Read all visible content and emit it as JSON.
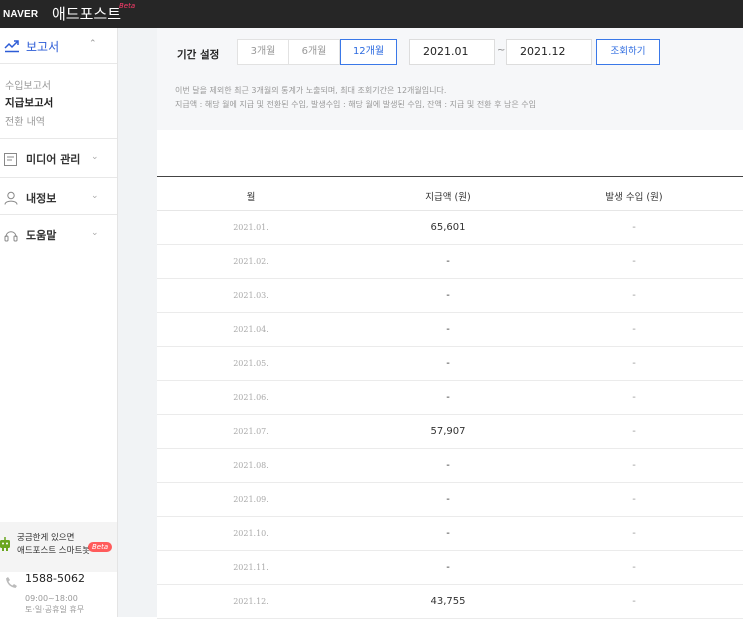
{
  "header": {
    "brand_naver": "NAVER",
    "brand_name": "애드포스트",
    "brand_badge": "Beta"
  },
  "sidebar": {
    "report": {
      "label": "보고서",
      "icon": "chart-line-icon"
    },
    "sub_items": [
      {
        "label": "수입보고서"
      },
      {
        "label": "지급보고서",
        "active": true
      },
      {
        "label": "전환 내역"
      }
    ],
    "menus": [
      {
        "label": "미디어 관리",
        "icon": "document-icon"
      },
      {
        "label": "내정보",
        "icon": "person-icon"
      },
      {
        "label": "도움말",
        "icon": "headset-icon"
      }
    ],
    "chatbot": {
      "line1": "궁금한게 있으면",
      "line2": "애드포스트 스마트봇",
      "badge": "Beta"
    },
    "phone": "1588-5062",
    "hours": "09:00~18:00",
    "days": "토·일·공휴일 휴무"
  },
  "filter": {
    "label": "기간 설정",
    "periods": [
      {
        "label": "3개월",
        "active": false
      },
      {
        "label": "6개월",
        "active": false
      },
      {
        "label": "12개월",
        "active": true
      }
    ],
    "start": "2021.01",
    "end": "2021.12",
    "tilde": "~",
    "search_label": "조회하기",
    "note1": "이번 달을 제외한 최근 3개월의 통계가 노출되며, 최대 조회기간은 12개월입니다.",
    "note2": "지급액 : 해당 월에 지급 및 전환된 수입, 발생수입 : 해당 월에 발생된 수입, 잔액 : 지급 및 전환 후 남은 수입"
  },
  "table": {
    "headers": {
      "month": "월",
      "paid": "지급액 (원)",
      "occurred": "발생 수입 (원)"
    },
    "rows": [
      {
        "month": "2021.01.",
        "paid": "65,601",
        "occurred": "-"
      },
      {
        "month": "2021.02.",
        "paid": "-",
        "occurred": "-"
      },
      {
        "month": "2021.03.",
        "paid": "-",
        "occurred": "-"
      },
      {
        "month": "2021.04.",
        "paid": "-",
        "occurred": "-"
      },
      {
        "month": "2021.05.",
        "paid": "-",
        "occurred": "-"
      },
      {
        "month": "2021.06.",
        "paid": "-",
        "occurred": "-"
      },
      {
        "month": "2021.07.",
        "paid": "57,907",
        "occurred": "-"
      },
      {
        "month": "2021.08.",
        "paid": "-",
        "occurred": "-"
      },
      {
        "month": "2021.09.",
        "paid": "-",
        "occurred": "-"
      },
      {
        "month": "2021.10.",
        "paid": "-",
        "occurred": "-"
      },
      {
        "month": "2021.11.",
        "paid": "-",
        "occurred": "-"
      },
      {
        "month": "2021.12.",
        "paid": "43,755",
        "occurred": "-"
      }
    ]
  },
  "colors": {
    "accent": "#2d6be0",
    "topbar": "#262626",
    "beta": "#ff5b5b",
    "bot": "#6aa61e"
  }
}
